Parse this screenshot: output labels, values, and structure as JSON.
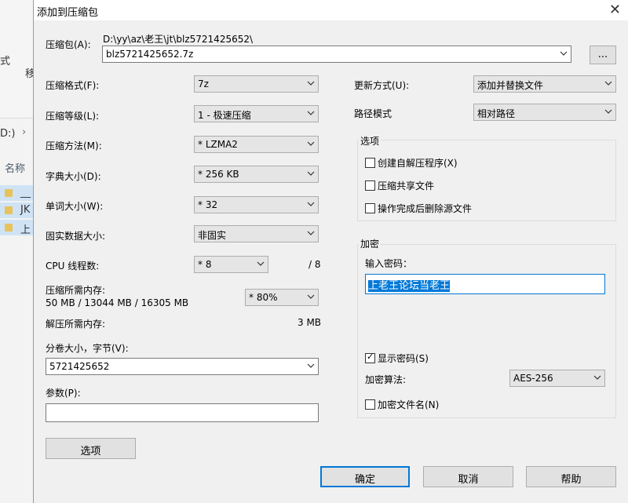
{
  "background_window": {
    "ribbon_text_1": "式",
    "ribbon_text_2": "移",
    "path_text": "D:)",
    "path_arrow": "›",
    "column_header": "名称",
    "items": [
      "__",
      "JK",
      "上"
    ]
  },
  "dialog": {
    "title": "添加到压缩包",
    "close_glyph": "✕",
    "archive": {
      "label": "压缩包(A):",
      "path": "D:\\yy\\az\\老王\\jt\\blz5721425652\\",
      "value": "blz5721425652.7z",
      "browse_label": "..."
    },
    "left": {
      "format_label": "压缩格式(F):",
      "format_value": "7z",
      "level_label": "压缩等级(L):",
      "level_value": "1 - 极速压缩",
      "method_label": "压缩方法(M):",
      "method_value": "* LZMA2",
      "dict_label": "字典大小(D):",
      "dict_value": "* 256 KB",
      "word_label": "单词大小(W):",
      "word_value": "* 32",
      "solid_label": "固实数据大小:",
      "solid_value": "非固实",
      "threads_label": "CPU 线程数:",
      "threads_value": "* 8",
      "threads_max": "/ 8",
      "mem_compress_label": "压缩所需内存:",
      "mem_compress_detail": "50 MB / 13044 MB / 16305 MB",
      "mem_percent_value": "* 80%",
      "mem_decompress_label": "解压所需内存:",
      "mem_decompress_value": "3 MB",
      "split_label": "分卷大小，字节(V):",
      "split_value": "5721425652",
      "params_label": "参数(P):",
      "params_value": "",
      "options_button": "选项"
    },
    "right": {
      "update_label": "更新方式(U):",
      "update_value": "添加并替换文件",
      "path_mode_label": "路径模式",
      "path_mode_value": "相对路径",
      "options_group": "选项",
      "sfx_label": "创建自解压程序(X)",
      "sfx_checked": false,
      "shared_label": "压缩共享文件",
      "shared_checked": false,
      "delete_label": "操作完成后删除源文件",
      "delete_checked": false,
      "encrypt_group": "加密",
      "password_label": "输入密码：",
      "password_value": "上老王论坛当老王",
      "show_password_label": "显示密码(S)",
      "show_password_checked": true,
      "algo_label": "加密算法:",
      "algo_value": "AES-256",
      "encrypt_names_label": "加密文件名(N)",
      "encrypt_names_checked": false
    },
    "buttons": {
      "ok": "确定",
      "cancel": "取消",
      "help": "帮助"
    },
    "check_glyph": "✓"
  }
}
